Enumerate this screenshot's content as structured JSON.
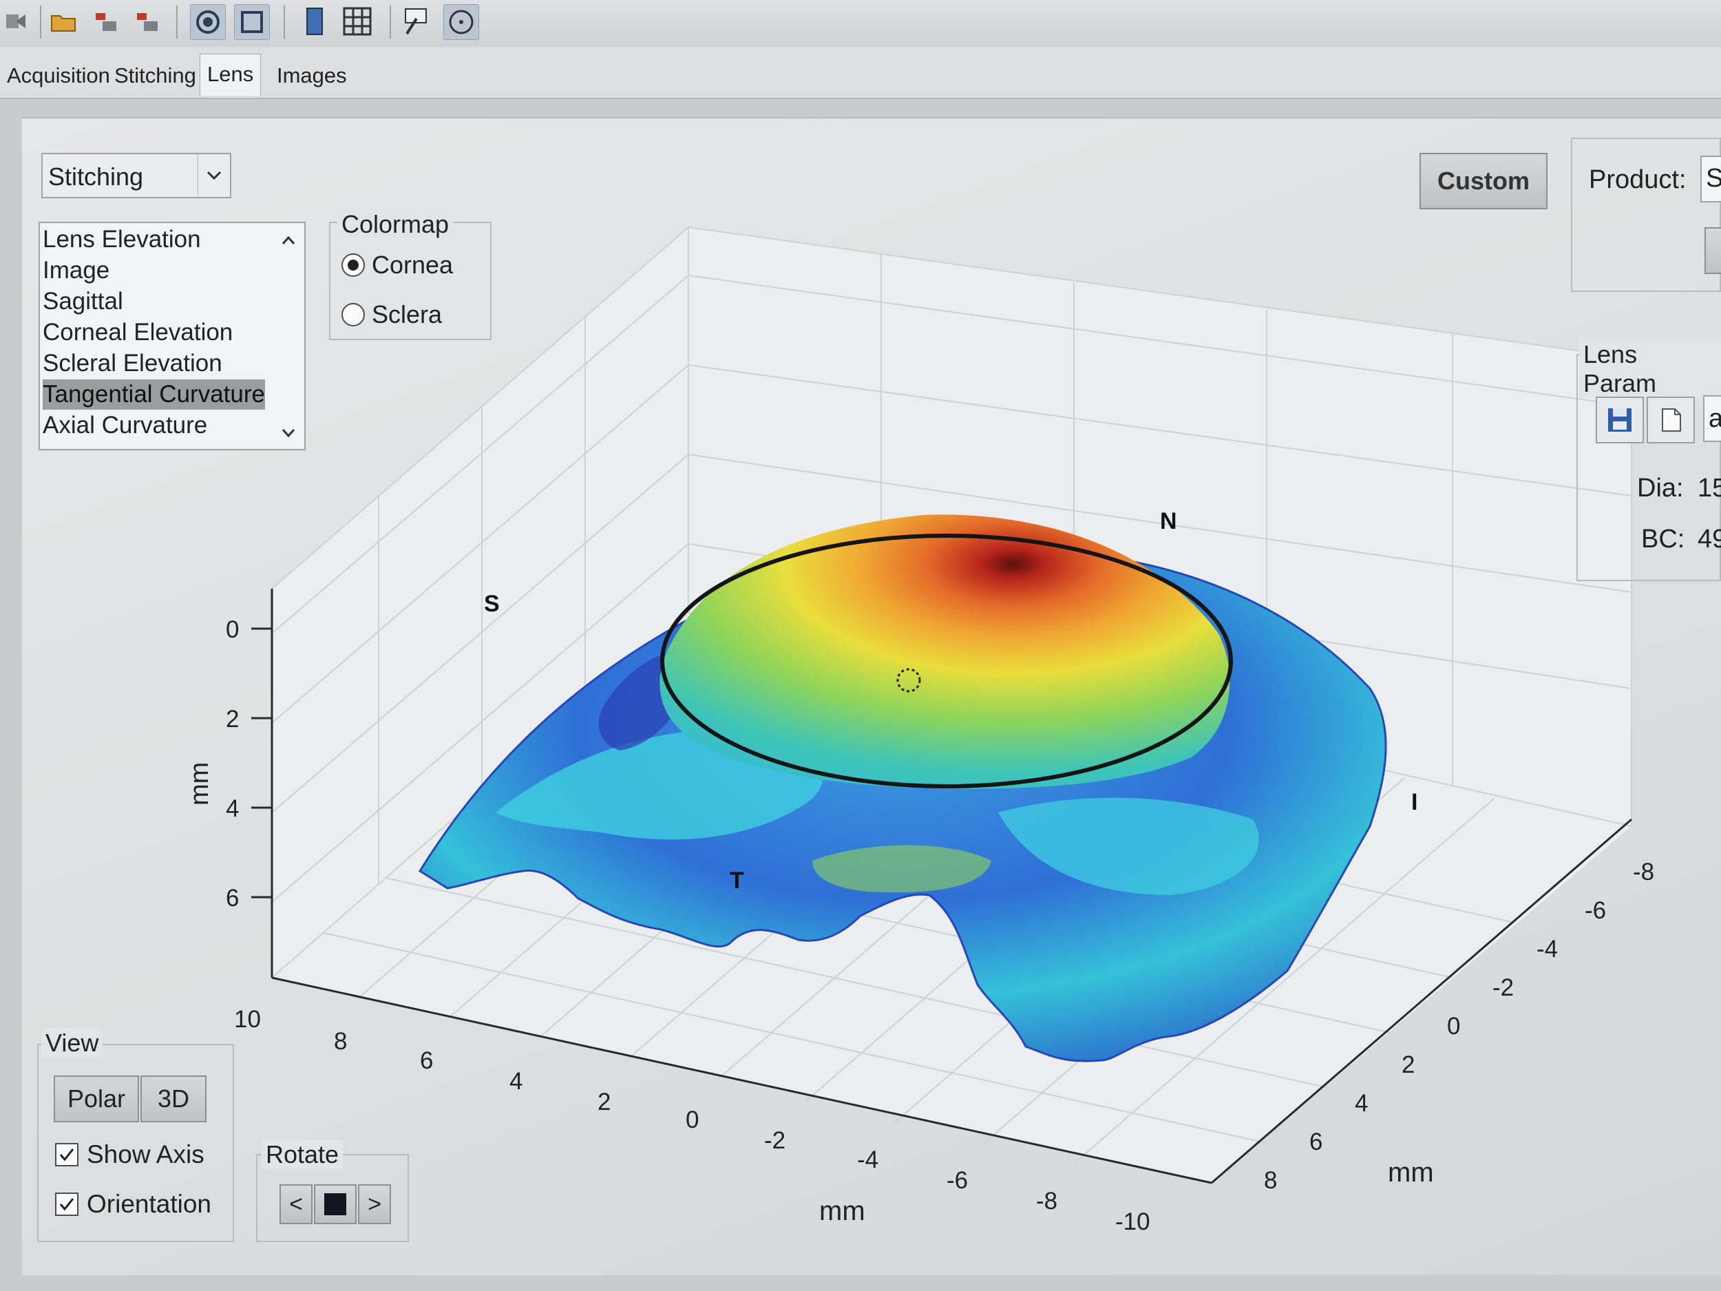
{
  "toolbar": {
    "icons": [
      "exit-icon",
      "open-folder-icon",
      "import-icon",
      "export-icon",
      "rotate-3d-icon",
      "crop-icon",
      "single-panel-icon",
      "grid-icon",
      "data-cursor-icon",
      "target-icon"
    ]
  },
  "tabs": [
    {
      "label": "Acquisition"
    },
    {
      "label": "Stitching"
    },
    {
      "label": "Lens",
      "active": true
    },
    {
      "label": "Images"
    }
  ],
  "dropdown": {
    "value": "Stitching"
  },
  "map_list": {
    "items": [
      "Lens Elevation",
      "Image",
      "Sagittal",
      "Corneal Elevation",
      "Scleral Elevation",
      "Tangential Curvature",
      "Axial Curvature"
    ],
    "selected": "Tangential Curvature"
  },
  "colormap": {
    "title": "Colormap",
    "options": [
      "Cornea",
      "Sclera"
    ],
    "selected": "Cornea"
  },
  "custom_button": "Custom",
  "product": {
    "label": "Product:",
    "value": "S"
  },
  "lens_params": {
    "title": "Lens Param",
    "field_value": "a",
    "dia_label": "Dia:",
    "dia_value": "15",
    "bc_label": "BC:",
    "bc_value": "49"
  },
  "view": {
    "title": "View",
    "polar_label": "Polar",
    "threed_label": "3D",
    "show_axis_label": "Show Axis",
    "show_axis_checked": true,
    "orientation_label": "Orientation",
    "orientation_checked": true
  },
  "rotate": {
    "title": "Rotate",
    "left": "<",
    "right": ">"
  },
  "plot": {
    "z_ticks": [
      "0",
      "2",
      "4",
      "6"
    ],
    "z_label": "mm",
    "x_ticks": [
      "10",
      "8",
      "6",
      "4",
      "2",
      "0",
      "-2",
      "-4",
      "-6",
      "-8",
      "-10"
    ],
    "x_label": "mm",
    "y_ticks": [
      "-8",
      "-6",
      "-4",
      "-2",
      "0",
      "2",
      "4",
      "6",
      "8"
    ],
    "y_label": "mm",
    "orientation_markers": [
      "S",
      "N",
      "T",
      "I"
    ],
    "colors": {
      "high": "#b8261b",
      "mid": "#e9de3c",
      "low": "#2a56c8",
      "base": "#35c1d8"
    }
  }
}
